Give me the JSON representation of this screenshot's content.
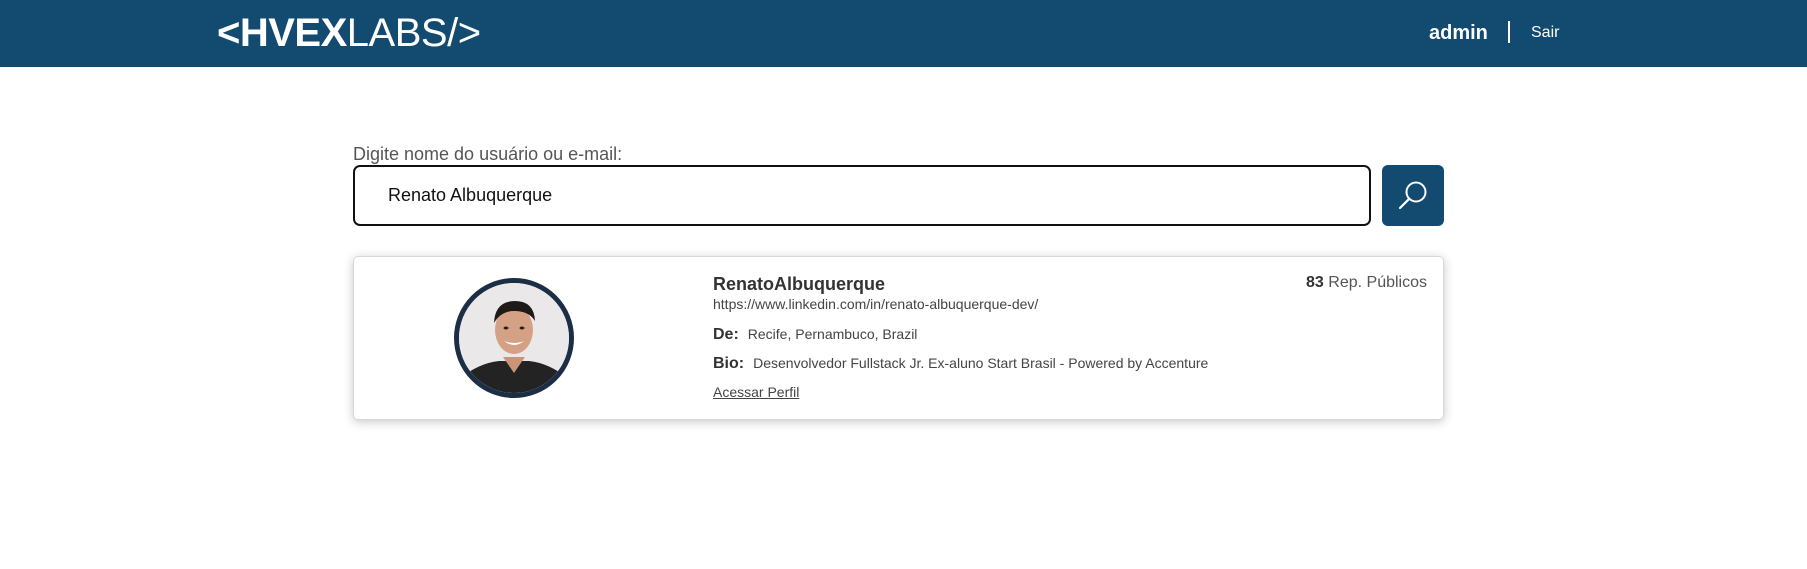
{
  "header": {
    "logo_bold": "<HVEX",
    "logo_light": "LABS/>",
    "username": "admin",
    "separator": "|",
    "logout_label": "Sair",
    "background_color": "#124a70"
  },
  "search": {
    "label": "Digite nome do usuário ou e-mail:",
    "value": "Renato Albuquerque",
    "button_icon": "search-icon"
  },
  "result": {
    "name": "RenatoAlbuquerque",
    "url": "https://www.linkedin.com/in/renato-albuquerque-dev/",
    "repos_count": "83",
    "repos_label": "Rep. Públicos",
    "from_label": "De:",
    "from_value": "Recife, Pernambuco, Brazil",
    "bio_label": "Bio:",
    "bio_value": "Desenvolvedor Fullstack Jr. Ex-aluno Start Brasil - Powered by Accenture",
    "profile_link": "Acessar Perfil",
    "avatar_icon": "user-avatar"
  }
}
